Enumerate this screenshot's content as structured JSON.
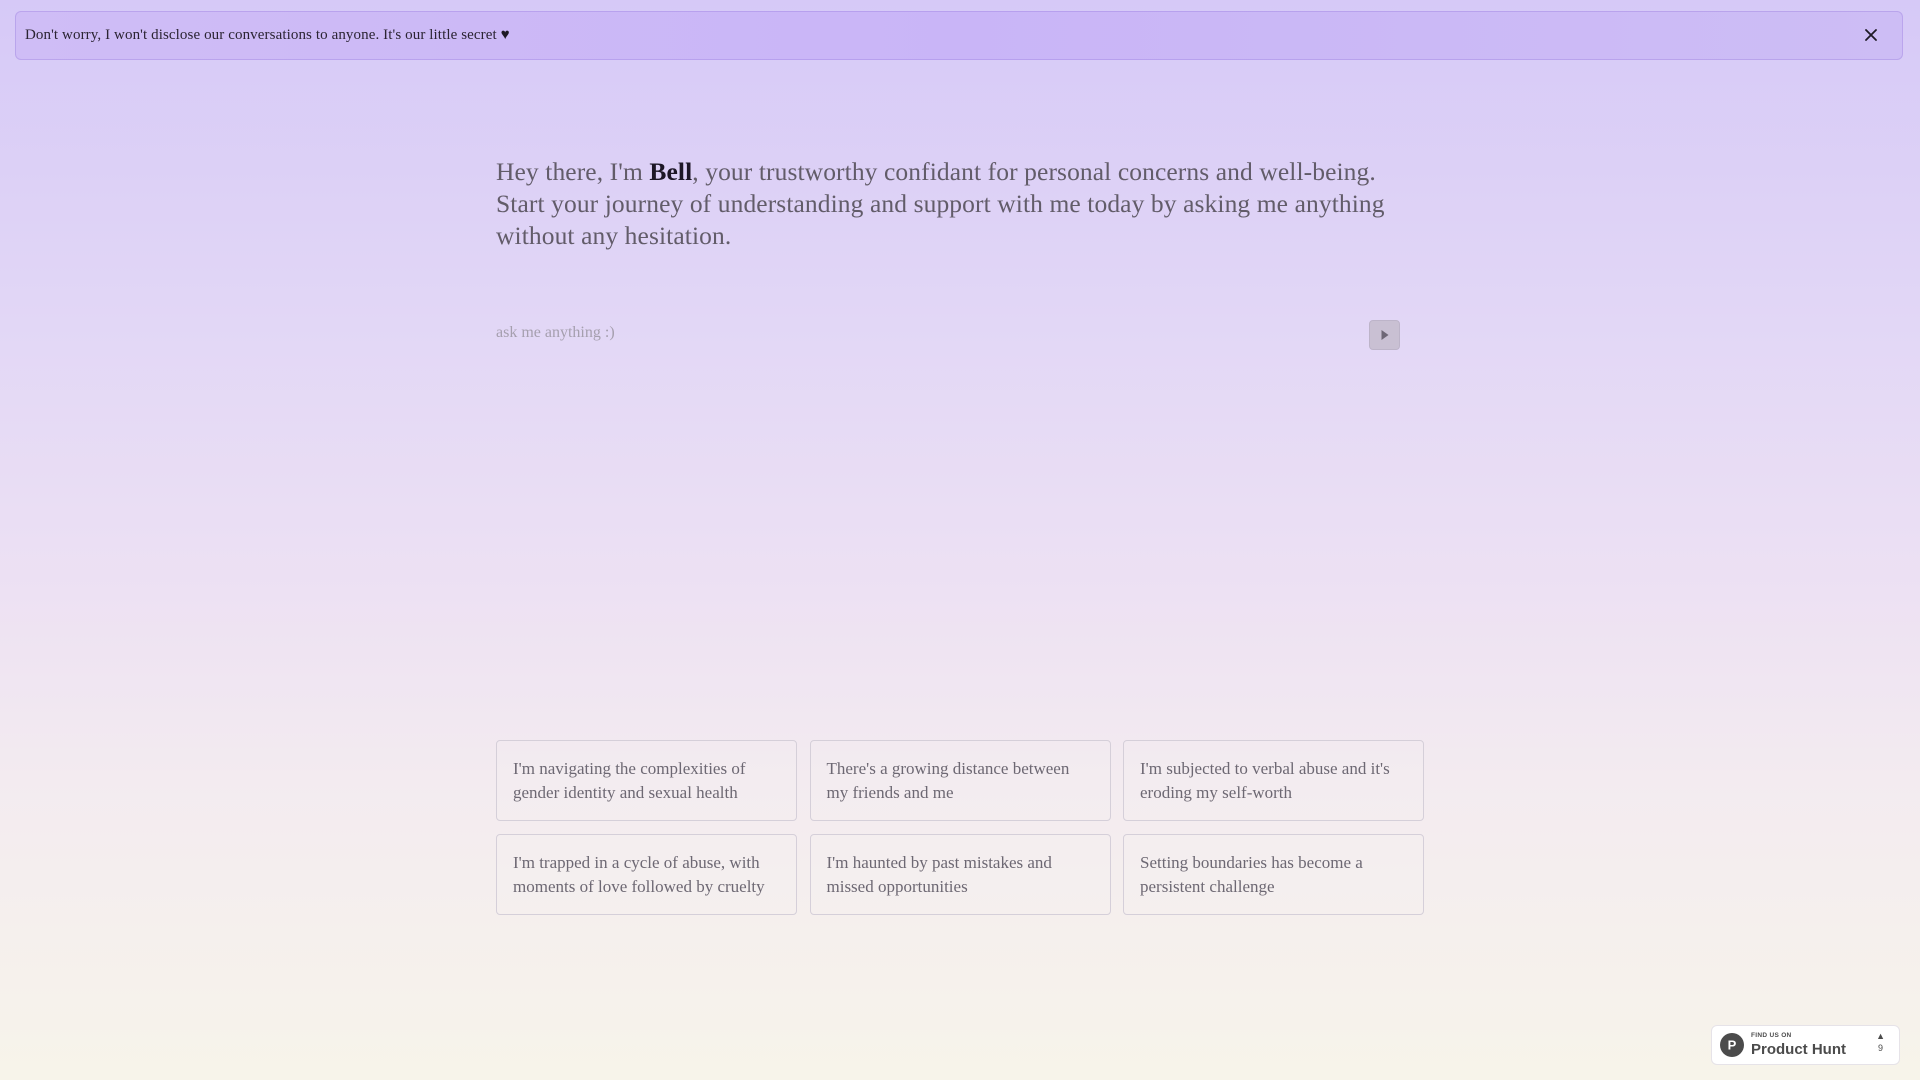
{
  "banner": {
    "message": "Don't worry, I won't disclose our conversations to anyone. It's our little secret",
    "heart": "♥",
    "close_icon": "close-icon"
  },
  "hero": {
    "intro": "Hey there, I'm ",
    "name": "Bell",
    "rest": ", your trustworthy confidant for personal concerns and well-being. Start your journey of understanding and support with me today by asking me anything without any hesitation."
  },
  "ask": {
    "placeholder": "ask me anything :)",
    "value": "",
    "send_icon": "play-icon"
  },
  "suggestions": [
    "I'm navigating the complexities of gender identity and sexual health",
    "There's a growing distance between my friends and me",
    "I'm subjected to verbal abuse and it's eroding my self-worth",
    "I'm trapped in a cycle of abuse, with moments of love followed by cruelty",
    "I'm haunted by past mistakes and missed opportunities",
    "Setting boundaries has become a persistent challenge"
  ],
  "product_hunt": {
    "small_label": "FIND US ON",
    "label": "Product Hunt",
    "arrow": "▲",
    "votes": "9",
    "logo_letter": "P"
  }
}
